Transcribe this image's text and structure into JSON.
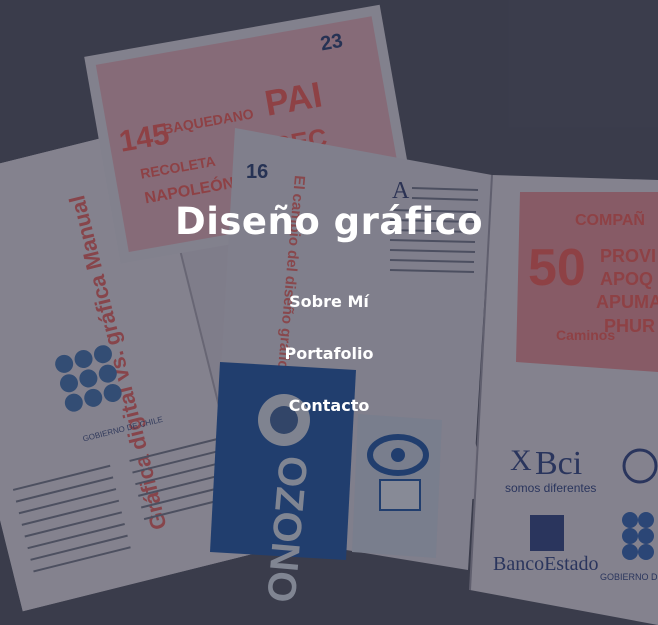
{
  "header": {
    "title": "Diseño gráfico"
  },
  "nav": {
    "items": [
      {
        "label": "Sobre Mí"
      },
      {
        "label": "Portafolio"
      },
      {
        "label": "Contacto"
      }
    ]
  },
  "background": {
    "page_number_left": "23",
    "page_number_center": "16",
    "headline_left": "Gráfica digital vs. gráfica Manual",
    "headline_center": "El cambio del diseño gráfico Digital / Manual",
    "poster_number": "50",
    "sponsor_bci": "Bci",
    "sponsor_bci_tagline": "somos diferentes",
    "sponsor_bancoestado": "BancoEstado",
    "sponsor_gobierno": "GOBIERNO DE CHILE",
    "ozono_text": "OZONO"
  },
  "colors": {
    "overlay": "#282a3a",
    "accent_red": "#e2554f",
    "accent_blue": "#1d4f9a"
  }
}
